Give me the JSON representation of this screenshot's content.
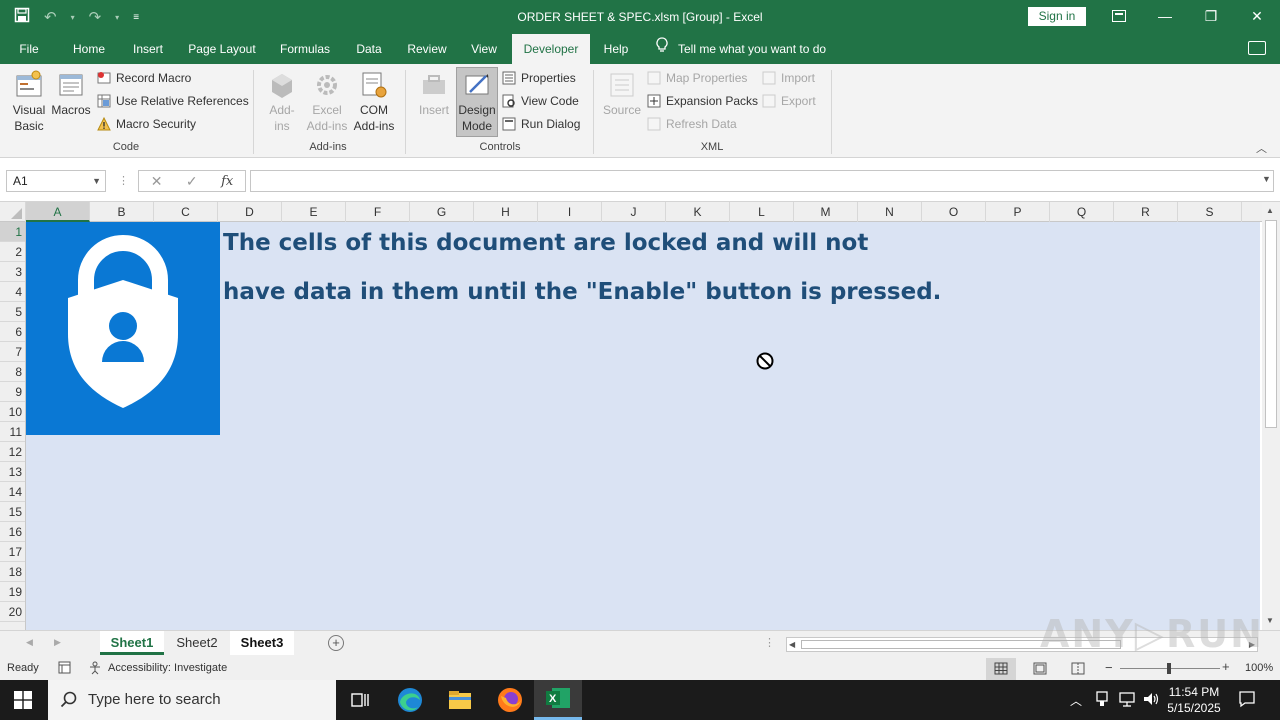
{
  "window": {
    "title": "ORDER SHEET & SPEC.xlsm  [Group]  -  Excel",
    "sign_in": "Sign in"
  },
  "ribbon_tabs": [
    "File",
    "Home",
    "Insert",
    "Page Layout",
    "Formulas",
    "Data",
    "Review",
    "View",
    "Developer",
    "Help"
  ],
  "active_tab": "Developer",
  "tell_me": "Tell me what you want to do",
  "groups": {
    "code": {
      "label": "Code",
      "visual_basic": "Visual Basic",
      "macros": "Macros",
      "record_macro": "Record Macro",
      "use_relative": "Use Relative References",
      "macro_security": "Macro Security"
    },
    "addins": {
      "label": "Add-ins",
      "addins": "Add-ins",
      "excel_addins": "Excel Add-ins",
      "com_addins": "COM Add-ins"
    },
    "controls": {
      "label": "Controls",
      "insert": "Insert",
      "design_mode": "Design Mode",
      "properties": "Properties",
      "view_code": "View Code",
      "run_dialog": "Run Dialog"
    },
    "xml": {
      "label": "XML",
      "source": "Source",
      "map_properties": "Map Properties",
      "expansion_packs": "Expansion Packs",
      "refresh_data": "Refresh Data",
      "import": "Import",
      "export": "Export"
    }
  },
  "formula_bar": {
    "name_box": "A1",
    "fx": "fx",
    "formula": ""
  },
  "columns": [
    "A",
    "B",
    "C",
    "D",
    "E",
    "F",
    "G",
    "H",
    "I",
    "J",
    "K",
    "L",
    "M",
    "N",
    "O",
    "P",
    "Q",
    "R",
    "S"
  ],
  "rows": [
    "1",
    "2",
    "3",
    "4",
    "5",
    "6",
    "7",
    "8",
    "9",
    "10",
    "11",
    "12",
    "13",
    "14",
    "15",
    "16",
    "17",
    "18",
    "19",
    "20"
  ],
  "sheet_message": {
    "line1": "The cells of this document are locked and will not",
    "line2": "have data in them until the \"Enable\" button is pressed."
  },
  "sheets": [
    "Sheet1",
    "Sheet2",
    "Sheet3"
  ],
  "active_sheet": "Sheet1",
  "status": {
    "ready": "Ready",
    "accessibility": "Accessibility: Investigate",
    "zoom": "100%"
  },
  "taskbar": {
    "search_placeholder": "Type here to search",
    "time": "11:54 PM",
    "date": "5/15/2025"
  },
  "colors": {
    "excel_green": "#217346",
    "sheet_fill": "#dae3f3",
    "lock_blue": "#0a78d4",
    "message_text": "#1f4e79"
  }
}
